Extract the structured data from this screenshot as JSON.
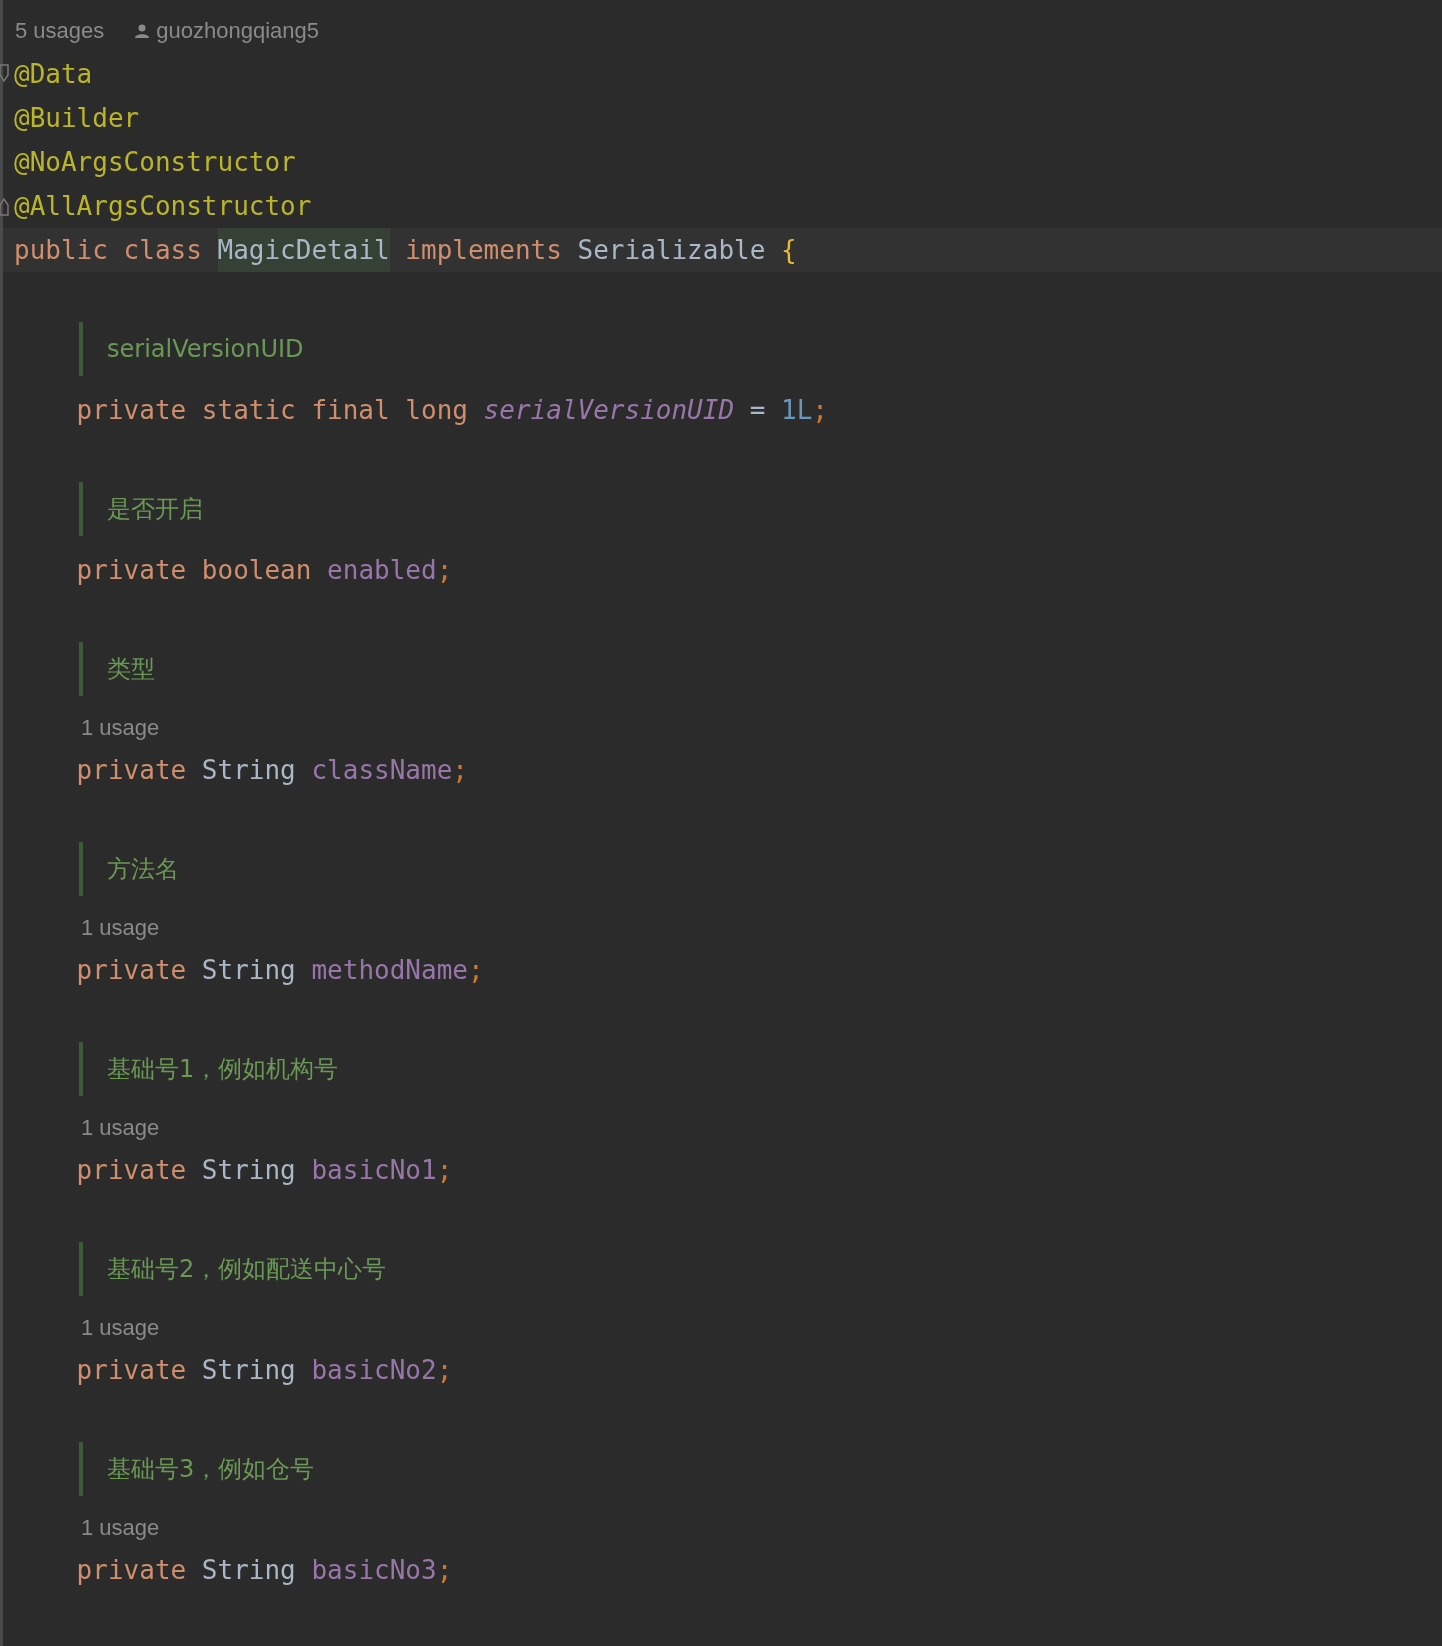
{
  "header": {
    "usages": "5 usages",
    "author": "guozhongqiang5"
  },
  "lines": [
    {
      "kind": "code",
      "fold_start": true,
      "current": false,
      "tokens": [
        {
          "kind": "annotation",
          "text": "@Data"
        }
      ]
    },
    {
      "kind": "code",
      "current": false,
      "tokens": [
        {
          "kind": "annotation",
          "text": "@Builder"
        }
      ]
    },
    {
      "kind": "code",
      "current": false,
      "tokens": [
        {
          "kind": "annotation",
          "text": "@NoArgsConstructor"
        }
      ]
    },
    {
      "kind": "code",
      "fold_end": true,
      "current": false,
      "tokens": [
        {
          "kind": "annotation",
          "text": "@AllArgsConstructor"
        }
      ]
    },
    {
      "kind": "code",
      "current": true,
      "tokens": [
        {
          "kind": "keyword",
          "text": "public class "
        },
        {
          "kind": "highlight",
          "text": "MagicDetail"
        },
        {
          "kind": "keyword",
          "text": " implements "
        },
        {
          "kind": "type",
          "text": "Serializable "
        },
        {
          "kind": "brace",
          "text": "{"
        }
      ]
    },
    {
      "kind": "doc",
      "text": "serialVersionUID"
    },
    {
      "kind": "code",
      "current": false,
      "tokens": [
        {
          "kind": "keyword",
          "text": "    private static final long "
        },
        {
          "kind": "static_field",
          "text": "serialVersionUID"
        },
        {
          "kind": "type",
          "text": " = "
        },
        {
          "kind": "number",
          "text": "1L"
        },
        {
          "kind": "punct",
          "text": ";"
        }
      ]
    },
    {
      "kind": "doc",
      "text": "是否开启"
    },
    {
      "kind": "code",
      "current": false,
      "tokens": [
        {
          "kind": "keyword",
          "text": "    private boolean "
        },
        {
          "kind": "field",
          "text": "enabled"
        },
        {
          "kind": "punct",
          "text": ";"
        }
      ]
    },
    {
      "kind": "doc",
      "text": "类型"
    },
    {
      "kind": "hint",
      "text": "1 usage"
    },
    {
      "kind": "code",
      "current": false,
      "tokens": [
        {
          "kind": "keyword",
          "text": "    private "
        },
        {
          "kind": "type",
          "text": "String "
        },
        {
          "kind": "field",
          "text": "className"
        },
        {
          "kind": "punct",
          "text": ";"
        }
      ]
    },
    {
      "kind": "doc",
      "text": "方法名"
    },
    {
      "kind": "hint",
      "text": "1 usage"
    },
    {
      "kind": "code",
      "current": false,
      "tokens": [
        {
          "kind": "keyword",
          "text": "    private "
        },
        {
          "kind": "type",
          "text": "String "
        },
        {
          "kind": "field",
          "text": "methodName"
        },
        {
          "kind": "punct",
          "text": ";"
        }
      ]
    },
    {
      "kind": "doc",
      "text": "基础号1，例如机构号"
    },
    {
      "kind": "hint",
      "text": "1 usage"
    },
    {
      "kind": "code",
      "current": false,
      "tokens": [
        {
          "kind": "keyword",
          "text": "    private "
        },
        {
          "kind": "type",
          "text": "String "
        },
        {
          "kind": "field",
          "text": "basicNo1"
        },
        {
          "kind": "punct",
          "text": ";"
        }
      ]
    },
    {
      "kind": "doc",
      "text": "基础号2，例如配送中心号"
    },
    {
      "kind": "hint",
      "text": "1 usage"
    },
    {
      "kind": "code",
      "current": false,
      "tokens": [
        {
          "kind": "keyword",
          "text": "    private "
        },
        {
          "kind": "type",
          "text": "String "
        },
        {
          "kind": "field",
          "text": "basicNo2"
        },
        {
          "kind": "punct",
          "text": ";"
        }
      ]
    },
    {
      "kind": "doc",
      "text": "基础号3，例如仓号"
    },
    {
      "kind": "hint",
      "text": "1 usage"
    },
    {
      "kind": "code",
      "current": false,
      "tokens": [
        {
          "kind": "keyword",
          "text": "    private "
        },
        {
          "kind": "type",
          "text": "String "
        },
        {
          "kind": "field",
          "text": "basicNo3"
        },
        {
          "kind": "punct",
          "text": ";"
        }
      ]
    }
  ]
}
